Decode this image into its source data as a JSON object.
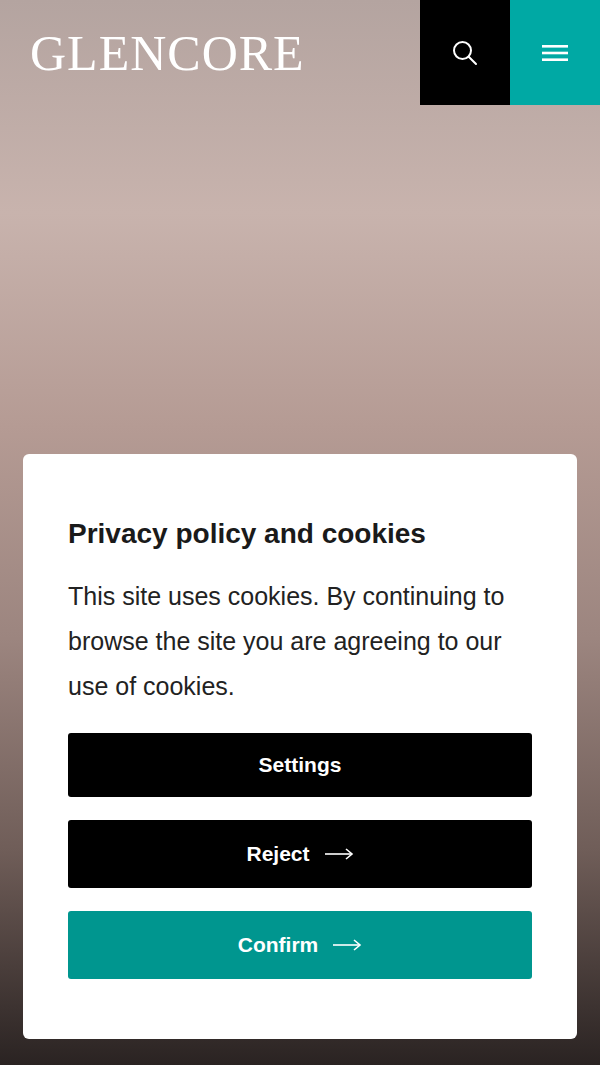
{
  "header": {
    "logo": "GLENCORE"
  },
  "cookie_dialog": {
    "title": "Privacy policy and cookies",
    "body": "This site uses cookies. By continuing to browse the site you are agreeing to our use of cookies.",
    "buttons": [
      {
        "label": "Settings",
        "kind": "plain"
      },
      {
        "label": "Reject",
        "kind": "arrow"
      },
      {
        "label": "Confirm",
        "kind": "primary"
      }
    ]
  }
}
